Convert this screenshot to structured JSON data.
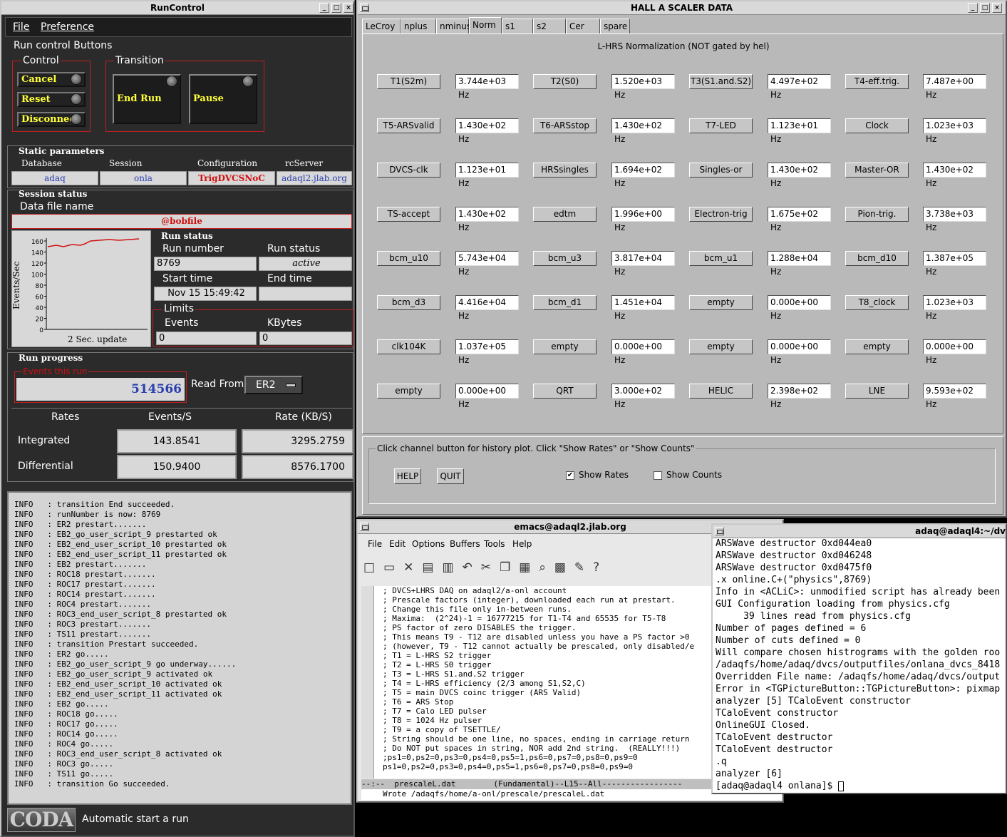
{
  "runcontrol": {
    "title": "RunControl",
    "menu": [
      "File",
      "Preference"
    ],
    "run_control_buttons_label": "Run control Buttons",
    "control_label": "Control",
    "transition_label": "Transition",
    "buttons": {
      "cancel": "Cancel",
      "reset": "Reset",
      "disconnect": "Disconnect",
      "end_run": "End Run",
      "pause": "Pause"
    },
    "static_parameters_label": "Static parameters",
    "static": {
      "database_label": "Database",
      "database": "adaq",
      "session_label": "Session",
      "session": "onla",
      "configuration_label": "Configuration",
      "configuration": "TrigDVCSNoC",
      "rcserver_label": "rcServer",
      "rcserver": "adaql2.jlab.org"
    },
    "session_status_label": "Session status",
    "data_file_label": "Data file name",
    "data_file": "@bobfile",
    "plot": {
      "ylabel": "Events/Sec",
      "xlabel": "2 Sec. update",
      "yticks": [
        "160",
        "140",
        "120",
        "100",
        "80",
        "60",
        "40",
        "20",
        "0"
      ]
    },
    "run_status_label": "Run status",
    "run_number_label": "Run number",
    "run_number": "8769",
    "run_status_field_label": "Run status",
    "run_status": "active",
    "start_time_label": "Start time",
    "start_time": "Nov 15 15:49:42",
    "end_time_label": "End time",
    "end_time": "",
    "limits_label": "Limits",
    "events_label": "Events",
    "events_limit": "0",
    "kbytes_label": "KBytes",
    "kbytes_limit": "0",
    "run_progress_label": "Run progress",
    "events_this_run_label": "Events this run",
    "events_this_run": "514566",
    "read_from_label": "Read From:",
    "read_from": "ER2",
    "rates_header": [
      "Rates",
      "Events/S",
      "Rate (KB/S)"
    ],
    "integrated_label": "Integrated",
    "integrated_events": "143.8541",
    "integrated_rate": "3295.2759",
    "differential_label": "Differential",
    "differential_events": "150.9400",
    "differential_rate": "8576.1700",
    "log": [
      "INFO   : transition End succeeded.",
      "INFO   : runNumber is now: 8769",
      "INFO   : ER2 prestart.......",
      "INFO   : EB2_go_user_script_9 prestarted ok",
      "INFO   : EB2_end_user_script_10 prestarted ok",
      "INFO   : EB2_end_user_script_11 prestarted ok",
      "INFO   : EB2 prestart.......",
      "INFO   : ROC18 prestart.......",
      "INFO   : ROC17 prestart.......",
      "INFO   : ROC14 prestart.......",
      "INFO   : ROC4 prestart.......",
      "INFO   : ROC3_end_user_script_8 prestarted ok",
      "INFO   : ROC3 prestart.......",
      "INFO   : TS11 prestart.......",
      "INFO   : transition Prestart succeeded.",
      "INFO   : ER2 go.....",
      "INFO   : EB2_go_user_script_9 go underway......",
      "INFO   : EB2_go_user_script_9 activated ok",
      "INFO   : EB2_end_user_script_10 activated ok",
      "INFO   : EB2_end_user_script_11 activated ok",
      "INFO   : EB2 go.....",
      "INFO   : ROC18 go.....",
      "INFO   : ROC17 go.....",
      "INFO   : ROC14 go.....",
      "INFO   : ROC4 go.....",
      "INFO   : ROC3_end_user_script_8 activated ok",
      "INFO   : ROC3 go.....",
      "INFO   : TS11 go.....",
      "INFO   : transition Go succeeded."
    ],
    "coda_logo": "CODA",
    "status_message": "Automatic start a run"
  },
  "scaler": {
    "title": "HALL  A   SCALER  DATA",
    "tabs": [
      "LeCroy",
      "nplus",
      "nminus",
      "Norm",
      "s1",
      "s2",
      "Cer",
      "spare"
    ],
    "active_tab": "Norm",
    "heading": "L-HRS Normalization (NOT gated by hel)",
    "channels": [
      [
        [
          "T1(S2m)",
          "3.744e+03 Hz"
        ],
        [
          "T2(S0)",
          "1.520e+03 Hz"
        ],
        [
          "T3(S1.and.S2)",
          "4.497e+02 Hz"
        ],
        [
          "T4-eff.trig.",
          "7.487e+00 Hz"
        ]
      ],
      [
        [
          "T5-ARSvalid",
          "1.430e+02 Hz"
        ],
        [
          "T6-ARSstop",
          "1.430e+02 Hz"
        ],
        [
          "T7-LED",
          "1.123e+01 Hz"
        ],
        [
          "Clock",
          "1.023e+03 Hz"
        ]
      ],
      [
        [
          "DVCS-clk",
          "1.123e+01 Hz"
        ],
        [
          "HRSsingles",
          "1.694e+02 Hz"
        ],
        [
          "Singles-or",
          "1.430e+02 Hz"
        ],
        [
          "Master-OR",
          "1.430e+02 Hz"
        ]
      ],
      [
        [
          "TS-accept",
          "1.430e+02 Hz"
        ],
        [
          "edtm",
          "1.996e+00 Hz"
        ],
        [
          "Electron-trig",
          "1.675e+02 Hz"
        ],
        [
          "Pion-trig.",
          "3.738e+03 Hz"
        ]
      ],
      [
        [
          "bcm_u10",
          "5.743e+04 Hz"
        ],
        [
          "bcm_u3",
          "3.817e+04 Hz"
        ],
        [
          "bcm_u1",
          "1.288e+04 Hz"
        ],
        [
          "bcm_d10",
          "1.387e+05 Hz"
        ]
      ],
      [
        [
          "bcm_d3",
          "4.416e+04 Hz"
        ],
        [
          "bcm_d1",
          "1.451e+04 Hz"
        ],
        [
          "empty",
          "0.000e+00 Hz"
        ],
        [
          "T8_clock",
          "1.023e+03 Hz"
        ]
      ],
      [
        [
          "clk104K",
          "1.037e+05 Hz"
        ],
        [
          "empty",
          "0.000e+00 Hz"
        ],
        [
          "empty",
          "0.000e+00 Hz"
        ],
        [
          "empty",
          "0.000e+00 Hz"
        ]
      ],
      [
        [
          "empty",
          "0.000e+00 Hz"
        ],
        [
          "QRT",
          "3.000e+02 Hz"
        ],
        [
          "HELIC",
          "2.398e+02 Hz"
        ],
        [
          "LNE",
          "9.593e+02 Hz"
        ]
      ]
    ],
    "instructions": "Click channel button for history plot.  Click \"Show Rates\" or \"Show Counts\"",
    "help": "HELP",
    "quit": "QUIT",
    "show_rates": "Show Rates",
    "show_counts": "Show Counts"
  },
  "emacs": {
    "title": "emacs@adaql2.jlab.org",
    "menu": [
      "File",
      "Edit",
      "Options",
      "Buffers",
      "Tools",
      "Help"
    ],
    "lines": [
      "; DVCS+LHRS DAQ on adaql2/a-onl account",
      "; Prescale factors (integer), downloaded each run at prestart.",
      "; Change this file only in-between runs.",
      "; Maxima:  (2^24)-1 = 16777215 for T1-T4 and 65535 for T5-T8",
      "; PS factor of zero DISABLES the trigger.",
      "; This means T9 - T12 are disabled unless you have a PS factor >0",
      "; (however, T9 - T12 cannot actually be prescaled, only disabled/e",
      "; T1 = L-HRS S2 trigger",
      "; T2 = L-HRS S0 trigger",
      "; T3 = L-HRS S1.and.S2 trigger",
      "; T4 = L-HRS efficiency (2/3 among S1,S2,C)",
      "; T5 = main DVCS coinc trigger (ARS Valid)",
      "; T6 = ARS Stop",
      "; T7 = Calo LED pulser",
      "; T8 = 1024 Hz pulser",
      "; T9 = a copy of TSETTLE/",
      "; String should be one line, no spaces, ending in carriage return",
      "; Do NOT put spaces in string, NOR add 2nd string.  (REALLY!!!)",
      ";ps1=0,ps2=0,ps3=0,ps4=0,ps5=1,ps6=0,ps7=0,ps8=0,ps9=0",
      "ps1=0,ps2=0,ps3=0,ps4=0,ps5=1,ps6=0,ps7=0,ps8=0,ps9=0"
    ],
    "modeline": "--:--  prescaleL.dat        (Fundamental)--L15--All-----------------",
    "echo": "Wrote /adaqfs/home/a-onl/prescale/prescaleL.dat"
  },
  "terminal": {
    "title": "adaq@adaql4:~/dv",
    "lines": [
      "ARSWave destructor 0xd044ea0",
      "ARSWave destructor 0xd046248",
      "ARSWave destructor 0xd0475f0",
      ".x online.C+(\"physics\",8769)",
      "Info in <ACLiC>: unmodified script has already been",
      "GUI Configuration loading from physics.cfg",
      "     39 lines read from physics.cfg",
      "Number of pages defined = 6",
      "Number of cuts defined = 0",
      "Will compare chosen histrograms with the golden roo",
      "/adaqfs/home/adaq/dvcs/outputfiles/onlana_dvcs_8418",
      "Overridden File name: /adaqfs/home/adaq/dvcs/output",
      "Error in <TGPictureButton::TGPictureButton>: pixmap",
      "analyzer [5] TCaloEvent constructor",
      "TCaloEvent constructor",
      "OnlineGUI Closed.",
      "TCaloEvent destructor",
      "TCaloEvent destructor",
      ".q",
      "analyzer [6]",
      "[adaq@adaql4 onlana]$ "
    ]
  }
}
